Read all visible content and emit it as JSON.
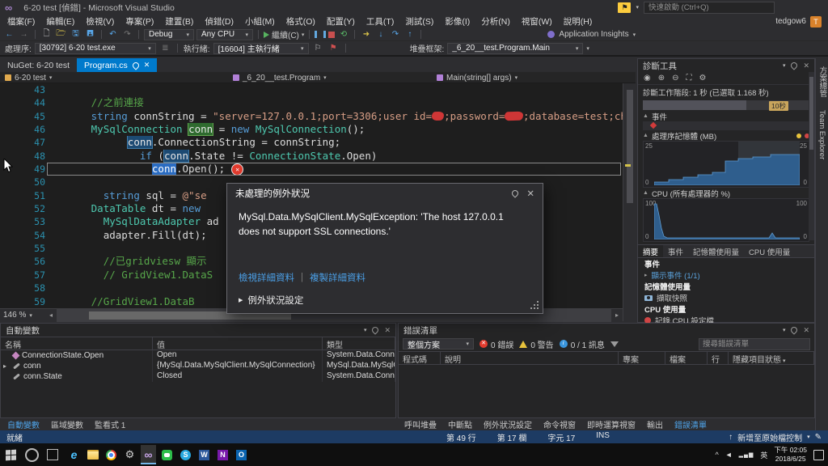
{
  "titlebar": {
    "title": "6-20 test [偵錯] - Microsoft Visual Studio",
    "quick_launch": "快速啟動 (Ctrl+Q)",
    "user_name": "tedgow6",
    "avatar_letter": "T"
  },
  "menu": {
    "items": [
      "檔案(F)",
      "編輯(E)",
      "檢視(V)",
      "專案(P)",
      "建置(B)",
      "偵錯(D)",
      "小組(M)",
      "格式(O)",
      "配置(Y)",
      "工具(T)",
      "測試(S)",
      "影像(I)",
      "分析(N)",
      "視窗(W)",
      "說明(H)"
    ]
  },
  "toolbar": {
    "config": "Debug",
    "platform": "Any CPU",
    "continue_label": "繼續(C)",
    "app_insights_label": "Application Insights"
  },
  "debug_toolbar": {
    "process_label": "處理序:",
    "process_value": "[30792] 6-20 test.exe",
    "thread_label": "執行緒:",
    "thread_value": "[16604] 主執行緒",
    "frame_label": "堆疊框架:",
    "frame_value": "_6_20__test.Program.Main"
  },
  "doc_tabs": {
    "nuget": "NuGet: 6-20 test",
    "active": "Program.cs"
  },
  "navbar": {
    "project": "6-20 test",
    "type": "_6_20__test.Program",
    "member": "Main(string[] args)"
  },
  "editor": {
    "zoom": "146 %",
    "lines": [
      {
        "n": 43,
        "tokens": []
      },
      {
        "n": 44,
        "tokens": [
          [
            "     ",
            "p"
          ],
          [
            "//之前連接",
            "c"
          ]
        ]
      },
      {
        "n": 45,
        "tokens": [
          [
            "     ",
            "p"
          ],
          [
            "string",
            "k"
          ],
          [
            " connString = ",
            "p"
          ],
          [
            "\"server=127.0.0.1;port=3306;user id=",
            "s"
          ],
          [
            "xx",
            "rd"
          ],
          [
            ";password=",
            "s"
          ],
          [
            "xxx",
            "rd"
          ],
          [
            ";database=test;charset=",
            "s"
          ]
        ]
      },
      {
        "n": 46,
        "tokens": [
          [
            "     ",
            "p"
          ],
          [
            "MySqlConnection",
            "t"
          ],
          [
            " ",
            "p"
          ],
          [
            "conn",
            "hg"
          ],
          [
            " = ",
            "p"
          ],
          [
            "new",
            "k"
          ],
          [
            " ",
            "p"
          ],
          [
            "MySqlConnection",
            "t"
          ],
          [
            "();",
            "p"
          ]
        ]
      },
      {
        "n": 47,
        "tokens": [
          [
            "           ",
            "p"
          ],
          [
            "conn",
            "hb"
          ],
          [
            ".ConnectionString = connString;",
            "p"
          ]
        ]
      },
      {
        "n": 48,
        "tokens": [
          [
            "             ",
            "p"
          ],
          [
            "if",
            "k"
          ],
          [
            " (",
            "p"
          ],
          [
            "conn",
            "hb"
          ],
          [
            ".State != ",
            "p"
          ],
          [
            "ConnectionState",
            "t"
          ],
          [
            ".Open)",
            "p"
          ]
        ]
      },
      {
        "n": 49,
        "current": true,
        "tokens": [
          [
            "               ",
            "p"
          ],
          [
            "conn",
            "sel"
          ],
          [
            ".Open();",
            "p"
          ]
        ]
      },
      {
        "n": 50,
        "tokens": []
      },
      {
        "n": 51,
        "tokens": [
          [
            "       ",
            "p"
          ],
          [
            "string",
            "k"
          ],
          [
            " sql = ",
            "p"
          ],
          [
            "@\"se",
            "s"
          ]
        ]
      },
      {
        "n": 52,
        "tokens": [
          [
            "     ",
            "p"
          ],
          [
            "DataTable",
            "t"
          ],
          [
            " dt = ",
            "p"
          ],
          [
            "new",
            "k"
          ]
        ]
      },
      {
        "n": 53,
        "tokens": [
          [
            "       ",
            "p"
          ],
          [
            "MySqlDataAdapter",
            "t"
          ],
          [
            " ad",
            "p"
          ]
        ]
      },
      {
        "n": 54,
        "tokens": [
          [
            "       ",
            "p"
          ],
          [
            "adapter.Fill(dt);",
            "p"
          ]
        ]
      },
      {
        "n": 55,
        "tokens": []
      },
      {
        "n": 56,
        "tokens": [
          [
            "       ",
            "p"
          ],
          [
            "//已gridviesw 顯示",
            "c"
          ]
        ]
      },
      {
        "n": 57,
        "tokens": [
          [
            "       ",
            "p"
          ],
          [
            "// GridView1.DataS",
            "c"
          ]
        ]
      },
      {
        "n": 58,
        "tokens": []
      },
      {
        "n": 59,
        "tokens": [
          [
            "     ",
            "p"
          ],
          [
            "//GridView1.DataB",
            "c"
          ]
        ]
      }
    ]
  },
  "exception_dialog": {
    "title": "未處理的例外狀況",
    "message": "MySql.Data.MySqlClient.MySqlException: 'The host 127.0.0.1 does not support SSL connections.'",
    "view_details": "檢視詳細資料",
    "copy_details": "複製詳細資料",
    "exception_settings": "例外狀況設定"
  },
  "diagnostics": {
    "title": "診斷工具",
    "session_text": "診斷工作階段: 1 秒 (已選取 1.168 秒)",
    "timeline_badge": "10秒",
    "events_label": "事件",
    "memory_label": "處理序記憶體 (MB)",
    "memory_axis_max": "25",
    "memory_axis_min": "0",
    "cpu_label": "CPU (所有處理器的 %)",
    "cpu_axis_max": "100",
    "cpu_axis_min": "0",
    "tabs": [
      "摘要",
      "事件",
      "記憶體使用量",
      "CPU 使用量"
    ],
    "active_tab": "摘要",
    "summary": {
      "events_header": "事件",
      "show_events": "顯示事件 (1/1)",
      "memory_header": "記憶體使用量",
      "snapshot": "擷取快照",
      "cpu_header": "CPU 使用量",
      "record": "記錄 CPU 設定檔"
    }
  },
  "autos": {
    "title": "自動變數",
    "columns": [
      "名稱",
      "值",
      "類型"
    ],
    "rows": [
      {
        "icon": "enum",
        "name": "ConnectionState.Open",
        "value": "Open",
        "type": "System.Data.Connecti"
      },
      {
        "icon": "field",
        "expander": true,
        "name": "conn",
        "value": "{MySql.Data.MySqlClient.MySqlConnection}",
        "type": "MySql.Data.MySqlClie"
      },
      {
        "icon": "field",
        "name": "conn.State",
        "value": "Closed",
        "type": "System.Data.Connecti"
      }
    ]
  },
  "error_list": {
    "title": "錯誤清單",
    "scope": "整個方案",
    "errors": "0 錯誤",
    "warnings": "0 警告",
    "messages": "0 / 1 訊息",
    "search_placeholder": "搜尋錯誤清單",
    "columns": [
      "程式碼",
      "說明",
      "專案",
      "檔案",
      "行",
      "隱藏項目狀態"
    ]
  },
  "panel_tabs": {
    "left": [
      "自動變數",
      "區域變數",
      "監看式 1"
    ],
    "left_active": "自動變數",
    "right": [
      "呼叫堆疊",
      "中斷點",
      "例外狀況設定",
      "命令視窗",
      "即時運算視窗",
      "輸出",
      "錯誤清單"
    ],
    "right_active": "錯誤清單"
  },
  "statusbar": {
    "ready": "就緒",
    "line": "第 49 行",
    "column": "第 17 欄",
    "character": "字元 17",
    "mode": "INS",
    "source_control": "新增至原始檔控制"
  },
  "side_rail": {
    "tabs": [
      "方案總管",
      "Team Explorer"
    ]
  },
  "taskbar": {
    "apps": [
      "edge",
      "file-explorer",
      "chrome",
      "settings",
      "visual-studio",
      "line",
      "skype",
      "word",
      "onenote",
      "outlook"
    ],
    "active_app": "visual-studio",
    "tray_lang": "英",
    "time": "下午 02:05",
    "date": "2018/6/25"
  }
}
